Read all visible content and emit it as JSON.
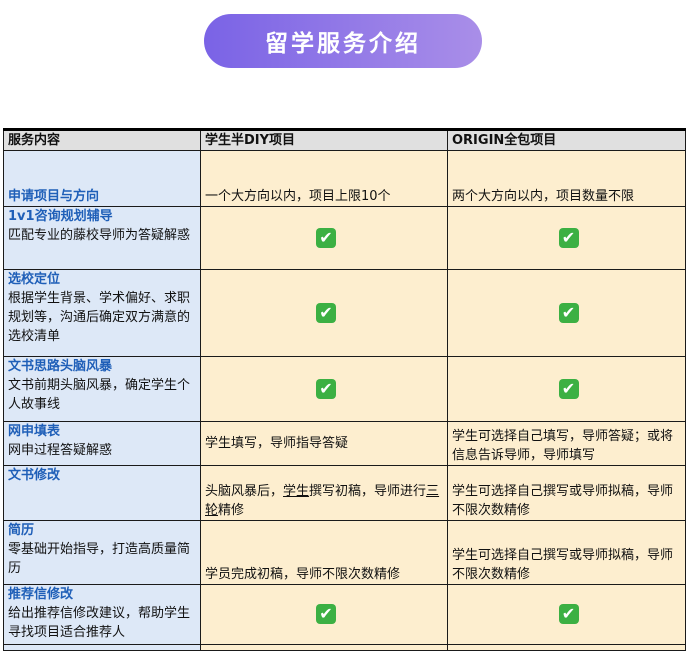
{
  "banner": {
    "title": "留学服务介绍"
  },
  "table": {
    "headers": [
      "服务内容",
      "学生半DIY项目",
      "ORIGIN全包项目"
    ],
    "rows": [
      {
        "title": "申请项目与方向",
        "desc": "",
        "diy": "一个大方向以内，项目上限10个",
        "origin": "两个大方向以内，项目数量不限"
      },
      {
        "title": "1v1咨询规划辅导",
        "desc": "匹配专业的藤校导师为答疑解惑",
        "diy": "✔",
        "origin": "✔"
      },
      {
        "title": "选校定位",
        "desc": "根据学生背景、学术偏好、求职规划等，沟通后确定双方满意的选校清单",
        "diy": "✔",
        "origin": "✔"
      },
      {
        "title": "文书思路头脑风暴",
        "desc": "文书前期头脑风暴，确定学生个人故事线",
        "diy": "✔",
        "origin": "✔"
      },
      {
        "title": "网申填表",
        "desc": "网申过程答疑解惑",
        "diy": "学生填写，导师指导答疑",
        "origin": "学生可选择自己填写，导师答疑；或将信息告诉导师，导师填写"
      },
      {
        "title": "文书修改",
        "desc": "",
        "diy_parts": [
          "头脑风暴后，",
          "学生",
          "撰写初稿，导师进行",
          "三轮",
          "精修"
        ],
        "origin": "学生可选择自己撰写或导师拟稿，导师不限次数精修"
      },
      {
        "title": "简历",
        "desc": "零基础开始指导，打造高质量简历",
        "diy": "学员完成初稿，导师不限次数精修",
        "origin": "学生可选择自己撰写或导师拟稿，导师不限次数精修"
      },
      {
        "title": "推荐信修改",
        "desc": "给出推荐信修改建议，帮助学生寻找项目适合推荐人",
        "diy": "✔",
        "origin": "✔"
      }
    ]
  },
  "colors": {
    "banner_start": "#7a63e6",
    "banner_end": "#a98ee8",
    "header_bg": "#e0e0e0",
    "col1_bg": "#dde8f7",
    "col23_bg": "#fdeecf",
    "title_color": "#1f5fb8",
    "check_bg": "#3cb043"
  }
}
